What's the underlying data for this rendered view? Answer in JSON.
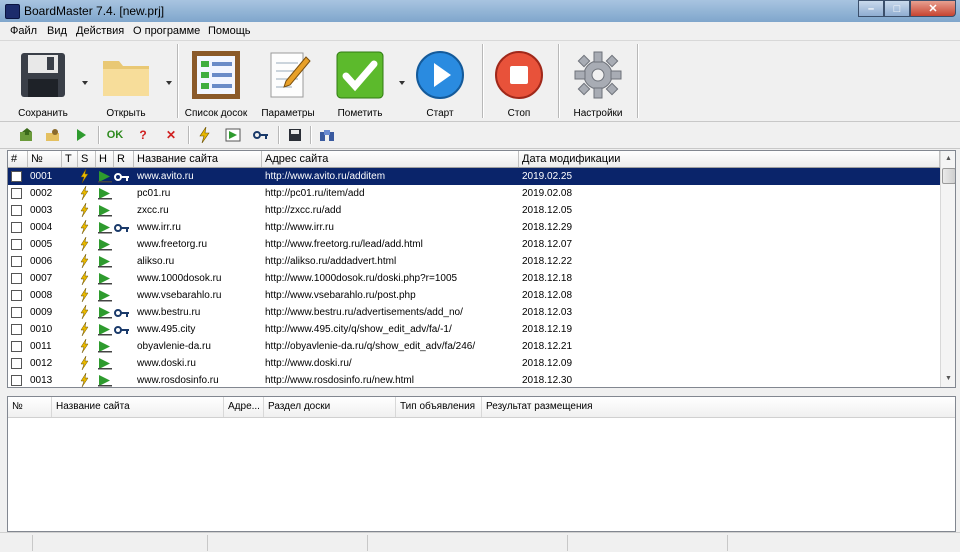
{
  "window": {
    "title": "BoardMaster 7.4. [new.prj]",
    "controls": {
      "minimize": "–",
      "maximize": "□",
      "close": "✕"
    }
  },
  "menu": [
    "Файл",
    "Вид",
    "Действия",
    "О программе",
    "Помощь"
  ],
  "toolbar": {
    "save": "Сохранить",
    "open": "Открыть",
    "board_list": "Список досок",
    "params": "Параметры",
    "mark": "Пометить",
    "start": "Старт",
    "stop": "Стоп",
    "settings": "Настройки"
  },
  "small_toolbar": {
    "ok_label": "OK",
    "question_label": "?",
    "cross_label": "✕"
  },
  "grid": {
    "columns": [
      "#",
      "№",
      "T",
      "S",
      "H",
      "R",
      "Название сайта",
      "Адрес сайта",
      "Дата модификации"
    ],
    "rows": [
      {
        "num": "0001",
        "name": "www.avito.ru",
        "url": "http://www.avito.ru/additem",
        "date": "2019.02.25",
        "key": true,
        "selected": true
      },
      {
        "num": "0002",
        "name": "pc01.ru",
        "url": "http://pc01.ru/item/add",
        "date": "2019.02.08",
        "key": false,
        "selected": false
      },
      {
        "num": "0003",
        "name": "zxcc.ru",
        "url": "http://zxcc.ru/add",
        "date": "2018.12.05",
        "key": false,
        "selected": false
      },
      {
        "num": "0004",
        "name": "www.irr.ru",
        "url": "http://www.irr.ru",
        "date": "2018.12.29",
        "key": true,
        "selected": false
      },
      {
        "num": "0005",
        "name": "www.freetorg.ru",
        "url": "http://www.freetorg.ru/lead/add.html",
        "date": "2018.12.07",
        "key": false,
        "selected": false
      },
      {
        "num": "0006",
        "name": "alikso.ru",
        "url": "http://alikso.ru/addadvert.html",
        "date": "2018.12.22",
        "key": false,
        "selected": false
      },
      {
        "num": "0007",
        "name": "www.1000dosok.ru",
        "url": "http://www.1000dosok.ru/doski.php?r=1005",
        "date": "2018.12.18",
        "key": false,
        "selected": false
      },
      {
        "num": "0008",
        "name": "www.vsebarahlo.ru",
        "url": "http://www.vsebarahlo.ru/post.php",
        "date": "2018.12.08",
        "key": false,
        "selected": false
      },
      {
        "num": "0009",
        "name": "www.bestru.ru",
        "url": "http://www.bestru.ru/advertisements/add_no/",
        "date": "2018.12.03",
        "key": true,
        "selected": false
      },
      {
        "num": "0010",
        "name": "www.495.city",
        "url": "http://www.495.city/q/show_edit_adv/fa/-1/",
        "date": "2018.12.19",
        "key": true,
        "selected": false
      },
      {
        "num": "0011",
        "name": "obyavlenie-da.ru",
        "url": "http://obyavlenie-da.ru/q/show_edit_adv/fa/246/",
        "date": "2018.12.21",
        "key": false,
        "selected": false
      },
      {
        "num": "0012",
        "name": "www.doski.ru",
        "url": "http://www.doski.ru/",
        "date": "2018.12.09",
        "key": false,
        "selected": false
      },
      {
        "num": "0013",
        "name": "www.rosdosinfo.ru",
        "url": "http://www.rosdosinfo.ru/new.html",
        "date": "2018.12.30",
        "key": false,
        "selected": false
      }
    ]
  },
  "lower": {
    "columns": [
      "№",
      "Название сайта",
      "Адре...",
      "Раздел доски",
      "Тип объявления",
      "Результат размещения"
    ]
  },
  "colors": {
    "selection": "#0a246a",
    "bolt": "#e8b800",
    "flag": "#2e9b2e"
  }
}
